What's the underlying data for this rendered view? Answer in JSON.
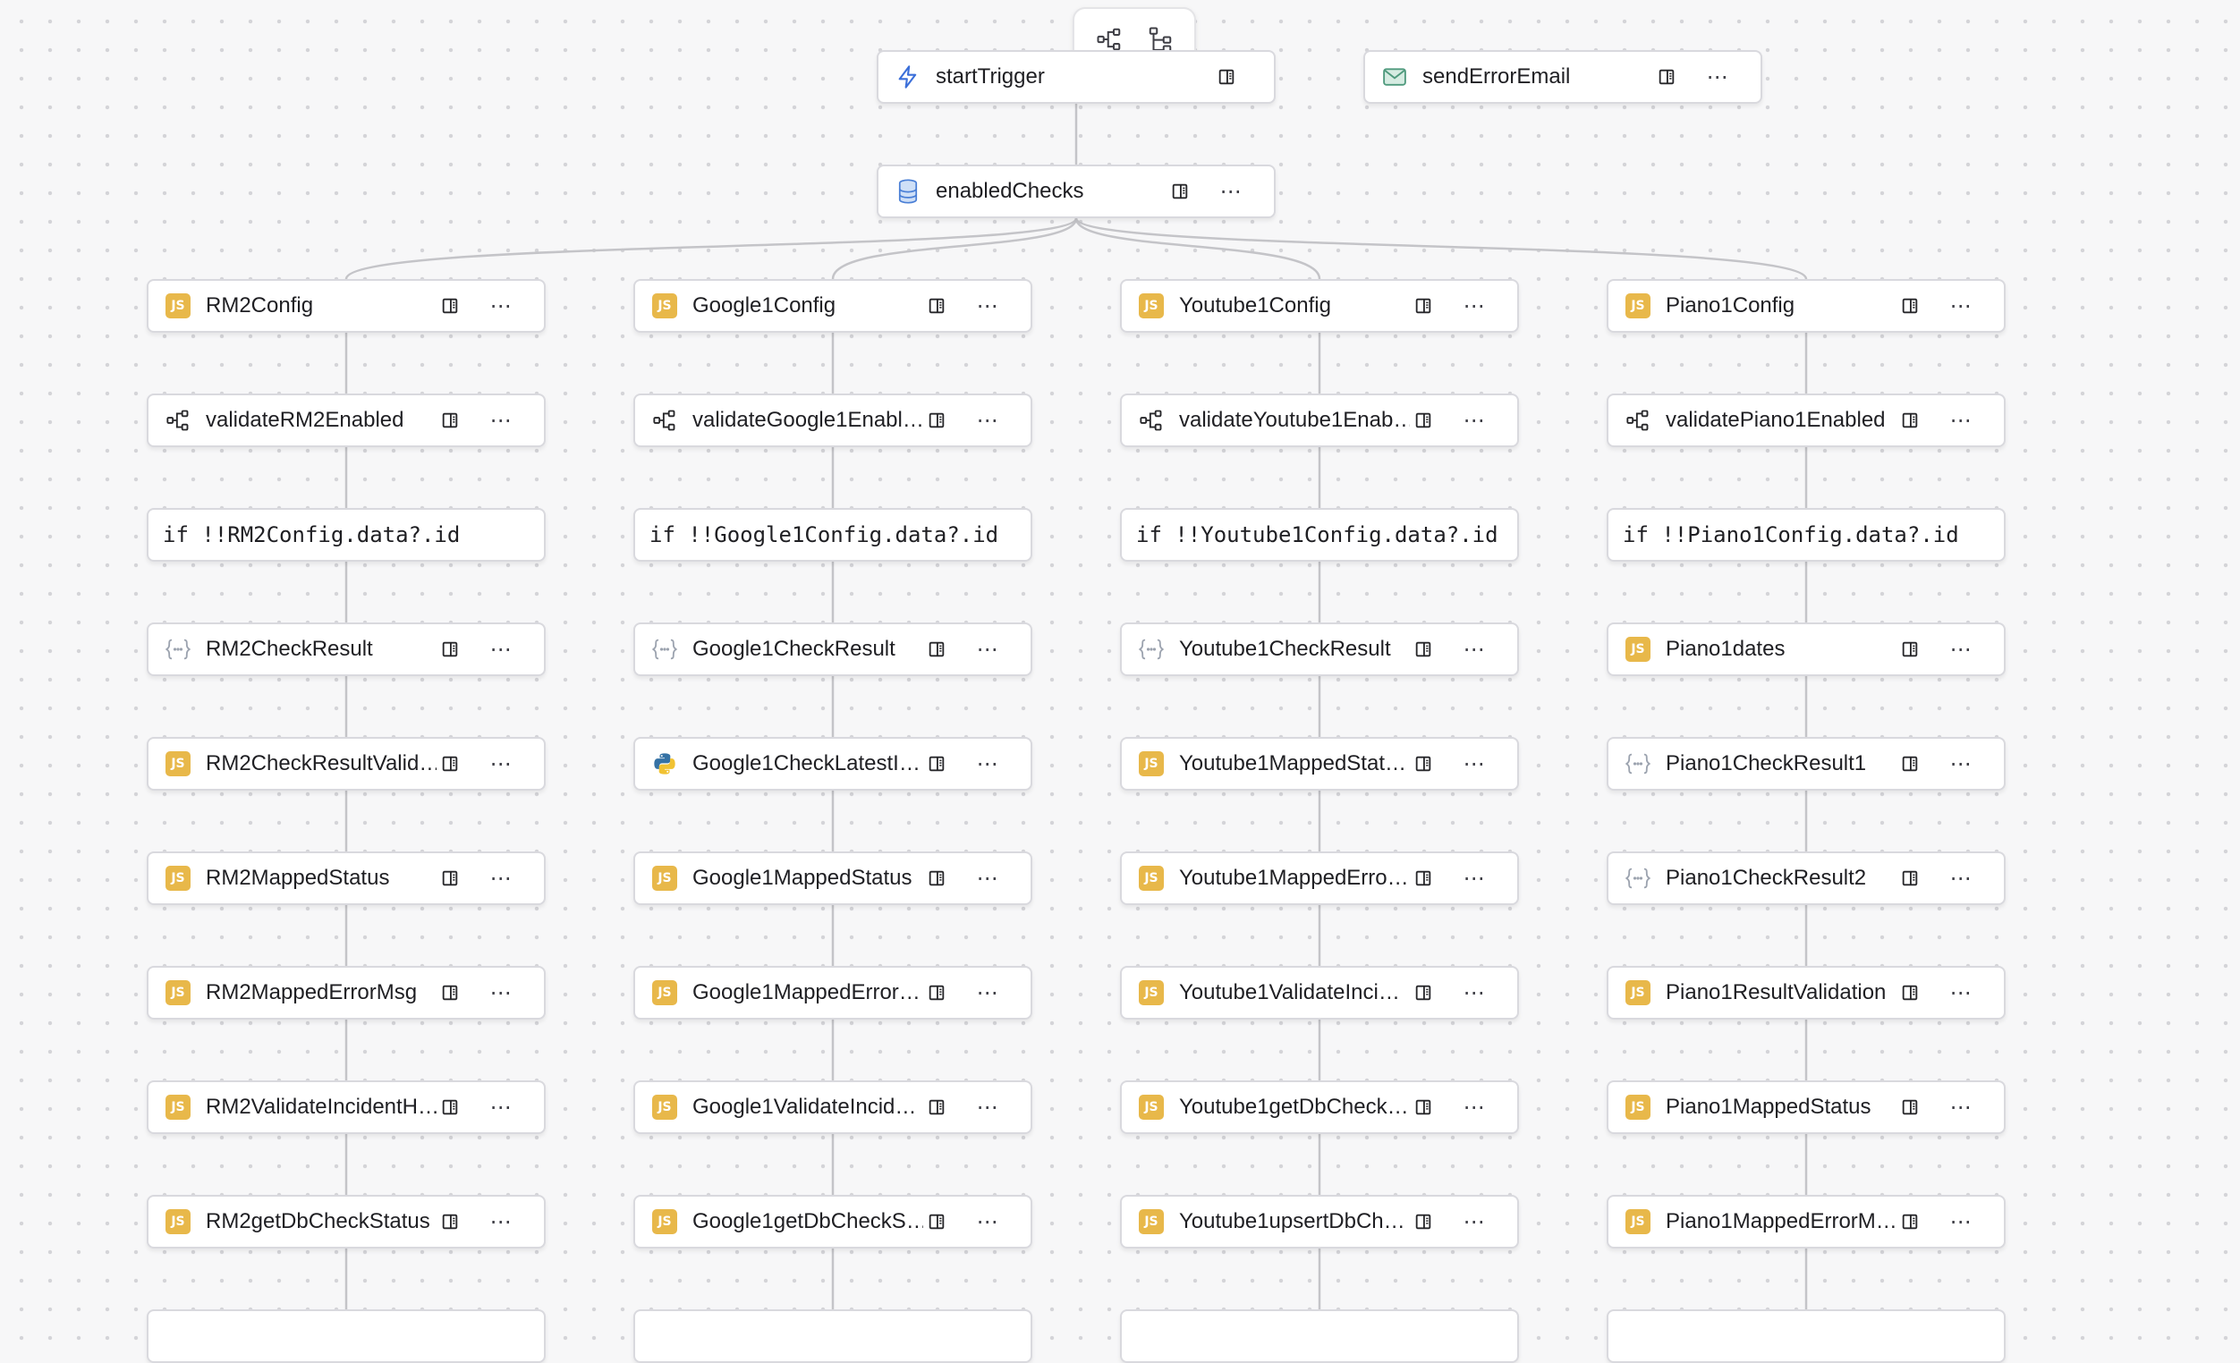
{
  "toolbar": {
    "buttons": [
      {
        "name": "graph-layout-icon"
      },
      {
        "name": "tree-layout-icon"
      }
    ]
  },
  "top_nodes": [
    {
      "name": "start-trigger-node",
      "label": "startTrigger",
      "icon": "lightning-icon",
      "more": false
    },
    {
      "name": "send-error-email-node",
      "label": "sendErrorEmail",
      "icon": "mail-icon",
      "more": true
    },
    {
      "name": "enabled-checks-node",
      "label": "enabledChecks",
      "icon": "database-icon",
      "more": true
    }
  ],
  "columns": [
    {
      "nodes": [
        {
          "label": "RM2Config",
          "icon": "js-icon"
        },
        {
          "label": "validateRM2Enabled",
          "icon": "branch-icon"
        },
        {
          "label": "if !!RM2Config.data?.id",
          "icon": "condition"
        },
        {
          "label": "RM2CheckResult",
          "icon": "variable-icon"
        },
        {
          "label": "RM2CheckResultValid…",
          "icon": "js-icon"
        },
        {
          "label": "RM2MappedStatus",
          "icon": "js-icon"
        },
        {
          "label": "RM2MappedErrorMsg",
          "icon": "js-icon"
        },
        {
          "label": "RM2ValidateIncidentH…",
          "icon": "js-icon"
        },
        {
          "label": "RM2getDbCheckStatus",
          "icon": "js-icon"
        }
      ]
    },
    {
      "nodes": [
        {
          "label": "Google1Config",
          "icon": "js-icon"
        },
        {
          "label": "validateGoogle1Enabl…",
          "icon": "branch-icon"
        },
        {
          "label": "if !!Google1Config.data?.id",
          "icon": "condition"
        },
        {
          "label": "Google1CheckResult",
          "icon": "variable-icon"
        },
        {
          "label": "Google1CheckLatestI…",
          "icon": "python-icon"
        },
        {
          "label": "Google1MappedStatus",
          "icon": "js-icon"
        },
        {
          "label": "Google1MappedError…",
          "icon": "js-icon"
        },
        {
          "label": "Google1ValidateIncid…",
          "icon": "js-icon"
        },
        {
          "label": "Google1getDbCheckS…",
          "icon": "js-icon"
        }
      ]
    },
    {
      "nodes": [
        {
          "label": "Youtube1Config",
          "icon": "js-icon"
        },
        {
          "label": "validateYoutube1Enab…",
          "icon": "branch-icon"
        },
        {
          "label": "if !!Youtube1Config.data?.id",
          "icon": "condition"
        },
        {
          "label": "Youtube1CheckResult",
          "icon": "variable-icon"
        },
        {
          "label": "Youtube1MappedStat…",
          "icon": "js-icon"
        },
        {
          "label": "Youtube1MappedErro…",
          "icon": "js-icon"
        },
        {
          "label": "Youtube1ValidateInci…",
          "icon": "js-icon"
        },
        {
          "label": "Youtube1getDbCheck…",
          "icon": "js-icon"
        },
        {
          "label": "Youtube1upsertDbCh…",
          "icon": "js-icon"
        }
      ]
    },
    {
      "nodes": [
        {
          "label": "Piano1Config",
          "icon": "js-icon"
        },
        {
          "label": "validatePiano1Enabled",
          "icon": "branch-icon"
        },
        {
          "label": "if !!Piano1Config.data?.id",
          "icon": "condition"
        },
        {
          "label": "Piano1dates",
          "icon": "js-icon"
        },
        {
          "label": "Piano1CheckResult1",
          "icon": "variable-icon"
        },
        {
          "label": "Piano1CheckResult2",
          "icon": "variable-icon"
        },
        {
          "label": "Piano1ResultValidation",
          "icon": "js-icon"
        },
        {
          "label": "Piano1MappedStatus",
          "icon": "js-icon"
        },
        {
          "label": "Piano1MappedErrorM…",
          "icon": "js-icon"
        }
      ]
    }
  ],
  "js_badge": "JS",
  "colors": {
    "edge": "#c4c4c8",
    "node_border": "#d9d9de",
    "js_badge": "#e8b84a",
    "lightning": "#3b6fd9",
    "mail": "#4f9a7d",
    "database": "#4a7fd6"
  }
}
